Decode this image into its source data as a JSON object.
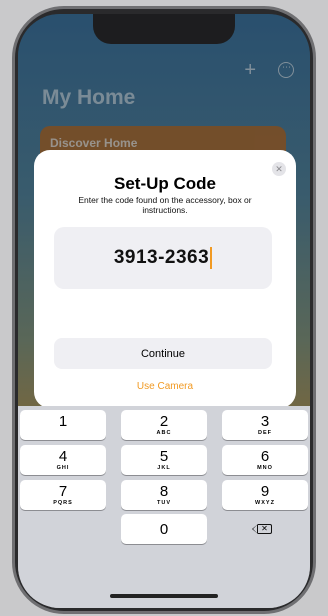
{
  "background": {
    "home_title": "My Home",
    "discover_card": "Discover Home",
    "actions": [
      "+",
      "⋯"
    ]
  },
  "setup_sheet": {
    "title": "Set-Up Code",
    "subtitle": "Enter the code found on the accessory, box or instructions.",
    "code_value": "3913-2363",
    "continue_label": "Continue",
    "camera_label": "Use Camera",
    "close_label": "✕",
    "accent_color": "#f19a23"
  },
  "keyboard": {
    "keys": [
      {
        "digit": "1",
        "letters": ""
      },
      {
        "digit": "2",
        "letters": "ABC"
      },
      {
        "digit": "3",
        "letters": "DEF"
      },
      {
        "digit": "4",
        "letters": "GHI"
      },
      {
        "digit": "5",
        "letters": "JKL"
      },
      {
        "digit": "6",
        "letters": "MNO"
      },
      {
        "digit": "7",
        "letters": "PQRS"
      },
      {
        "digit": "8",
        "letters": "TUV"
      },
      {
        "digit": "9",
        "letters": "WXYZ"
      },
      {
        "digit": "0",
        "letters": ""
      }
    ],
    "delete_icon": "delete-backward-icon"
  }
}
